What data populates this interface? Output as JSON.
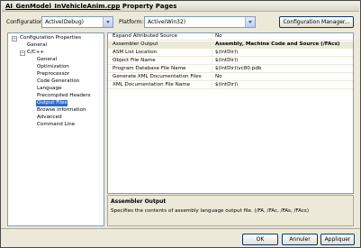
{
  "window": {
    "title": "AI_GenModel_InVehicleAnim.cpp Property Pages",
    "title_underlined_part": "AI_GenModel_InVehicleAnim.cpp"
  },
  "toolbar": {
    "configuration_label": "Configuration:",
    "configuration_value": "Active(Debug)",
    "platform_label": "Platform:",
    "platform_value": "Active(Win32)",
    "config_manager_label": "Configuration Manager..."
  },
  "tree": {
    "root": "Configuration Properties",
    "general": "General",
    "cpp": "C/C++",
    "children": [
      "General",
      "Optimization",
      "Preprocessor",
      "Code Generation",
      "Language",
      "Precompiled Headers",
      "Output Files",
      "Browse Information",
      "Advanced",
      "Command Line"
    ],
    "selected": "Output Files"
  },
  "properties": [
    {
      "name": "Expand Attributed Source",
      "value": "No"
    },
    {
      "name": "Assembler Output",
      "value": "Assembly, Machine Code and Source (/FAcs)"
    },
    {
      "name": "ASM List Location",
      "value": "$(IntDir)\\"
    },
    {
      "name": "Object File Name",
      "value": "$(IntDir)\\"
    },
    {
      "name": "Program Database File Name",
      "value": "$(IntDir)\\vc80.pdb"
    },
    {
      "name": "Generate XML Documentation Files",
      "value": "No"
    },
    {
      "name": "XML Documentation File Name",
      "value": "$(IntDir)\\"
    }
  ],
  "description": {
    "title": "Assembler Output",
    "text": "Specifies the contents of assembly language output file.     (/FA, /FAc, /FAs, /FAcs)"
  },
  "buttons": {
    "ok": "OK",
    "cancel": "Annuler",
    "apply": "Appliquer"
  },
  "colors": {
    "selection": "#316ac5",
    "dialog_bg": "#ece9d8",
    "border_blue": "#7f9db9"
  }
}
